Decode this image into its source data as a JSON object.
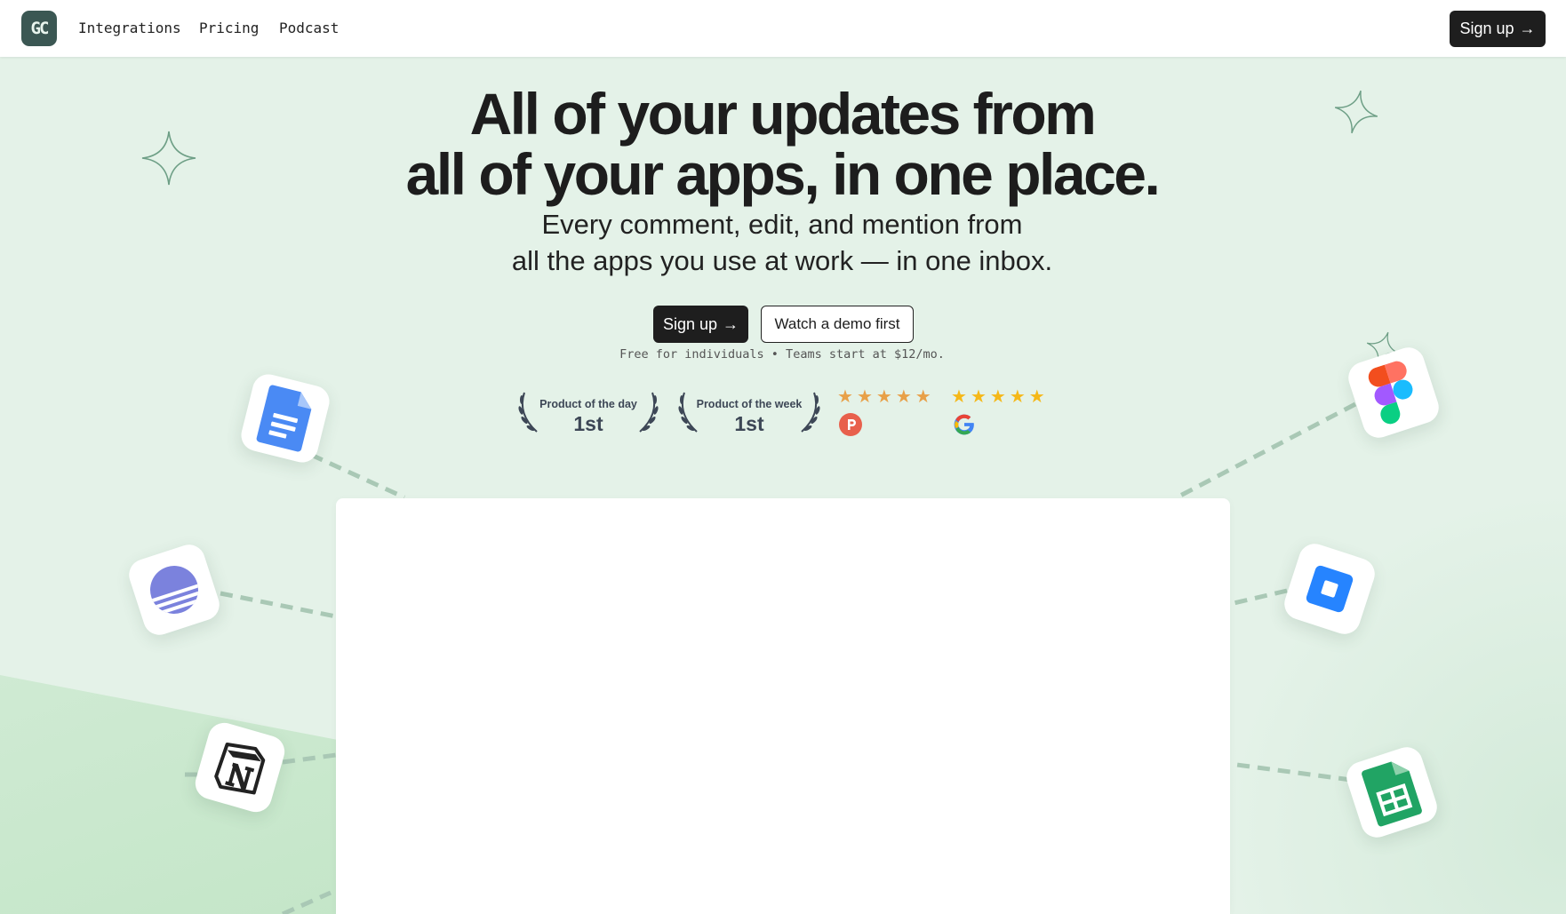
{
  "header": {
    "logo_text": "GC",
    "nav": [
      "Integrations",
      "Pricing",
      "Podcast"
    ],
    "signup_label": "Sign up",
    "signup_arrow": "→"
  },
  "hero": {
    "title_line1": "All of your updates from",
    "title_line2": "all of your apps, in one place.",
    "sub_line1": "Every comment, edit, and mention from",
    "sub_line2": "all the apps you use at work — in one inbox.",
    "primary_cta": "Sign up",
    "cta_arrow": "→",
    "secondary_cta": "Watch a demo first",
    "pricing_note": "Free for individuals • Teams start at $12/mo."
  },
  "badges": {
    "awards": [
      {
        "label": "Product of the day",
        "rank": "1st"
      },
      {
        "label": "Product of the week",
        "rank": "1st"
      }
    ],
    "ratings": [
      {
        "source_icon": "product-hunt-icon",
        "stars": 5,
        "color": "#e8a048"
      },
      {
        "source_icon": "google-icon",
        "stars": 5,
        "color": "#f5b818"
      }
    ]
  },
  "apps": [
    "google-docs-icon",
    "linear-icon",
    "notion-icon",
    "figma-icon",
    "jira-icon",
    "google-sheets-icon"
  ],
  "colors": {
    "background": "#e4f2e8",
    "dark_button": "#1e1e1e",
    "logo_bg": "#3b5753",
    "connector": "#a9c8b5"
  }
}
